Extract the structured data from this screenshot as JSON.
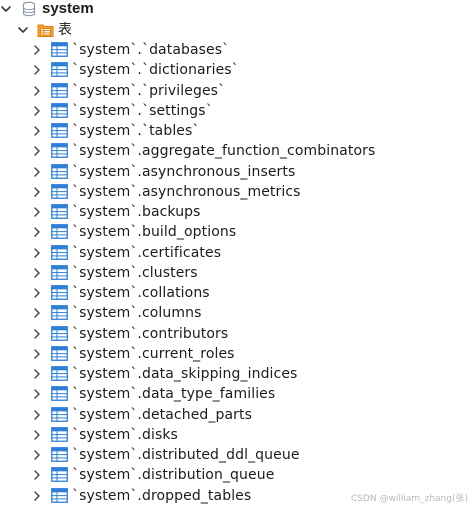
{
  "tree": {
    "database": {
      "label": "system",
      "icon": "database-icon",
      "expanded": true
    },
    "folder": {
      "label": "表",
      "icon": "table-folder-icon",
      "expanded": true
    },
    "tables": [
      {
        "label": "`system`.`databases`"
      },
      {
        "label": "`system`.`dictionaries`"
      },
      {
        "label": "`system`.`privileges`"
      },
      {
        "label": "`system`.`settings`"
      },
      {
        "label": "`system`.`tables`"
      },
      {
        "label": "`system`.aggregate_function_combinators"
      },
      {
        "label": "`system`.asynchronous_inserts"
      },
      {
        "label": "`system`.asynchronous_metrics"
      },
      {
        "label": "`system`.backups"
      },
      {
        "label": "`system`.build_options"
      },
      {
        "label": "`system`.certificates"
      },
      {
        "label": "`system`.clusters"
      },
      {
        "label": "`system`.collations"
      },
      {
        "label": "`system`.columns"
      },
      {
        "label": "`system`.contributors"
      },
      {
        "label": "`system`.current_roles"
      },
      {
        "label": "`system`.data_skipping_indices"
      },
      {
        "label": "`system`.data_type_families"
      },
      {
        "label": "`system`.detached_parts"
      },
      {
        "label": "`system`.disks"
      },
      {
        "label": "`system`.distributed_ddl_queue"
      },
      {
        "label": "`system`.distribution_queue"
      },
      {
        "label": "`system`.dropped_tables"
      }
    ]
  },
  "watermark": "CSDN @william_zhang(张)",
  "colors": {
    "table_icon_blue": "#2f7fd6",
    "folder_icon_orange": "#f08a12",
    "database_icon_gray": "#8a94a6"
  }
}
